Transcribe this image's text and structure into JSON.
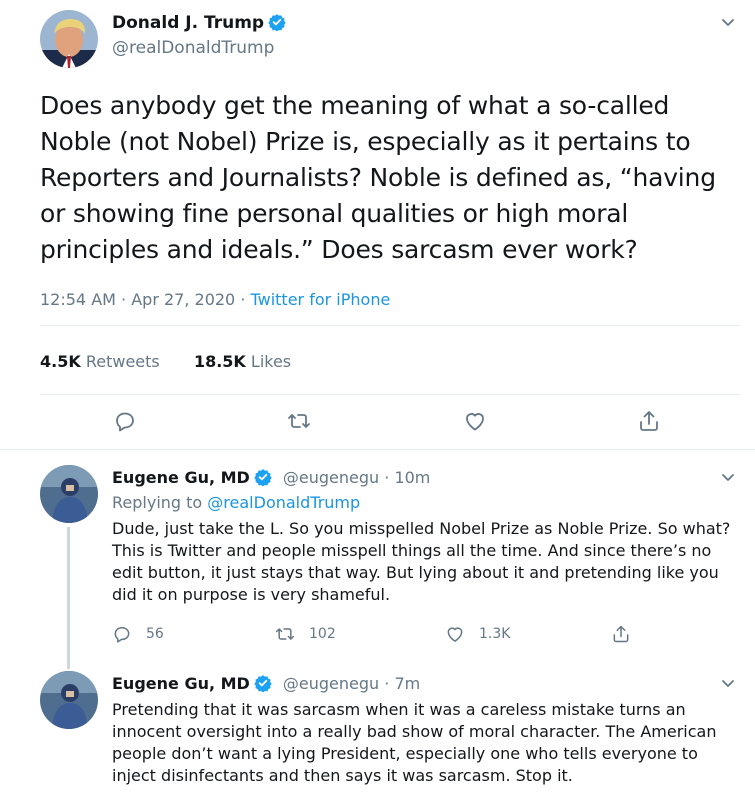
{
  "main_tweet": {
    "author_name": "Donald J. Trump",
    "author_handle": "@realDonaldTrump",
    "text": "Does anybody get the meaning of what a so-called Noble (not Nobel) Prize is, especially as it pertains to Reporters and Journalists? Noble is defined as, “having or showing fine personal qualities or high moral principles and ideals.” Does sarcasm ever work?",
    "time": "12:54 AM",
    "date": "Apr 27, 2020",
    "source": "Twitter for iPhone",
    "retweets_count": "4.5K",
    "retweets_label": "Retweets",
    "likes_count": "18.5K",
    "likes_label": "Likes",
    "icons": [
      "reply-icon",
      "retweet-icon",
      "like-icon",
      "share-icon"
    ]
  },
  "replies": [
    {
      "author_name": "Eugene Gu, MD",
      "author_handle": "@eugenegu",
      "age": "10m",
      "replying_prefix": "Replying to",
      "replying_to": "@realDonaldTrump",
      "text": "Dude, just take the L. So you misspelled Nobel Prize as Noble Prize. So what? This is Twitter and people misspell things all the time.  And since there’s no edit button, it just stays that way. But lying about it and pretending like you did it on purpose is very shameful.",
      "reply_count": "56",
      "retweet_count": "102",
      "like_count": "1.3K"
    },
    {
      "author_name": "Eugene Gu, MD",
      "author_handle": "@eugenegu",
      "age": "7m",
      "text": "Pretending that it was sarcasm when it was a careless mistake turns an innocent oversight into a really bad show of moral character. The American people don’t want a lying President, especially one who tells everyone to inject disinfectants and then says it was sarcasm. Stop it."
    }
  ],
  "colors": {
    "accent": "#1da1f2",
    "link": "#1b95e0",
    "muted": "#657786",
    "text": "#14171a",
    "divider": "#e6ecf0"
  }
}
